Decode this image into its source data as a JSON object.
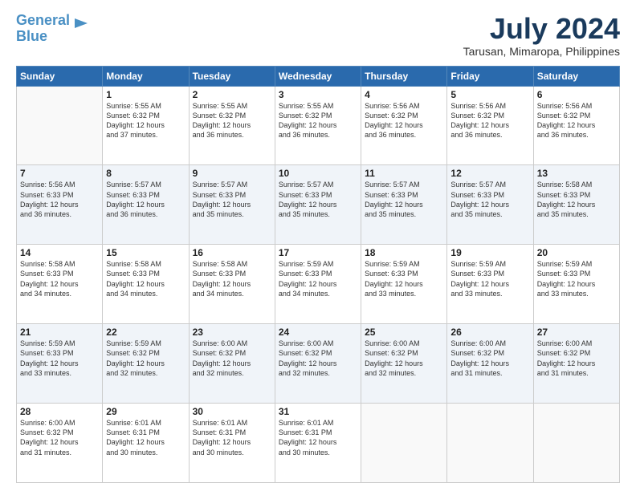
{
  "logo": {
    "line1": "General",
    "line2": "Blue"
  },
  "header": {
    "title": "July 2024",
    "location": "Tarusan, Mimaropa, Philippines"
  },
  "days_of_week": [
    "Sunday",
    "Monday",
    "Tuesday",
    "Wednesday",
    "Thursday",
    "Friday",
    "Saturday"
  ],
  "weeks": [
    [
      {
        "day": "",
        "info": ""
      },
      {
        "day": "1",
        "info": "Sunrise: 5:55 AM\nSunset: 6:32 PM\nDaylight: 12 hours\nand 37 minutes."
      },
      {
        "day": "2",
        "info": "Sunrise: 5:55 AM\nSunset: 6:32 PM\nDaylight: 12 hours\nand 36 minutes."
      },
      {
        "day": "3",
        "info": "Sunrise: 5:55 AM\nSunset: 6:32 PM\nDaylight: 12 hours\nand 36 minutes."
      },
      {
        "day": "4",
        "info": "Sunrise: 5:56 AM\nSunset: 6:32 PM\nDaylight: 12 hours\nand 36 minutes."
      },
      {
        "day": "5",
        "info": "Sunrise: 5:56 AM\nSunset: 6:32 PM\nDaylight: 12 hours\nand 36 minutes."
      },
      {
        "day": "6",
        "info": "Sunrise: 5:56 AM\nSunset: 6:32 PM\nDaylight: 12 hours\nand 36 minutes."
      }
    ],
    [
      {
        "day": "7",
        "info": "Sunrise: 5:56 AM\nSunset: 6:33 PM\nDaylight: 12 hours\nand 36 minutes."
      },
      {
        "day": "8",
        "info": "Sunrise: 5:57 AM\nSunset: 6:33 PM\nDaylight: 12 hours\nand 36 minutes."
      },
      {
        "day": "9",
        "info": "Sunrise: 5:57 AM\nSunset: 6:33 PM\nDaylight: 12 hours\nand 35 minutes."
      },
      {
        "day": "10",
        "info": "Sunrise: 5:57 AM\nSunset: 6:33 PM\nDaylight: 12 hours\nand 35 minutes."
      },
      {
        "day": "11",
        "info": "Sunrise: 5:57 AM\nSunset: 6:33 PM\nDaylight: 12 hours\nand 35 minutes."
      },
      {
        "day": "12",
        "info": "Sunrise: 5:57 AM\nSunset: 6:33 PM\nDaylight: 12 hours\nand 35 minutes."
      },
      {
        "day": "13",
        "info": "Sunrise: 5:58 AM\nSunset: 6:33 PM\nDaylight: 12 hours\nand 35 minutes."
      }
    ],
    [
      {
        "day": "14",
        "info": "Sunrise: 5:58 AM\nSunset: 6:33 PM\nDaylight: 12 hours\nand 34 minutes."
      },
      {
        "day": "15",
        "info": "Sunrise: 5:58 AM\nSunset: 6:33 PM\nDaylight: 12 hours\nand 34 minutes."
      },
      {
        "day": "16",
        "info": "Sunrise: 5:58 AM\nSunset: 6:33 PM\nDaylight: 12 hours\nand 34 minutes."
      },
      {
        "day": "17",
        "info": "Sunrise: 5:59 AM\nSunset: 6:33 PM\nDaylight: 12 hours\nand 34 minutes."
      },
      {
        "day": "18",
        "info": "Sunrise: 5:59 AM\nSunset: 6:33 PM\nDaylight: 12 hours\nand 33 minutes."
      },
      {
        "day": "19",
        "info": "Sunrise: 5:59 AM\nSunset: 6:33 PM\nDaylight: 12 hours\nand 33 minutes."
      },
      {
        "day": "20",
        "info": "Sunrise: 5:59 AM\nSunset: 6:33 PM\nDaylight: 12 hours\nand 33 minutes."
      }
    ],
    [
      {
        "day": "21",
        "info": "Sunrise: 5:59 AM\nSunset: 6:33 PM\nDaylight: 12 hours\nand 33 minutes."
      },
      {
        "day": "22",
        "info": "Sunrise: 5:59 AM\nSunset: 6:32 PM\nDaylight: 12 hours\nand 32 minutes."
      },
      {
        "day": "23",
        "info": "Sunrise: 6:00 AM\nSunset: 6:32 PM\nDaylight: 12 hours\nand 32 minutes."
      },
      {
        "day": "24",
        "info": "Sunrise: 6:00 AM\nSunset: 6:32 PM\nDaylight: 12 hours\nand 32 minutes."
      },
      {
        "day": "25",
        "info": "Sunrise: 6:00 AM\nSunset: 6:32 PM\nDaylight: 12 hours\nand 32 minutes."
      },
      {
        "day": "26",
        "info": "Sunrise: 6:00 AM\nSunset: 6:32 PM\nDaylight: 12 hours\nand 31 minutes."
      },
      {
        "day": "27",
        "info": "Sunrise: 6:00 AM\nSunset: 6:32 PM\nDaylight: 12 hours\nand 31 minutes."
      }
    ],
    [
      {
        "day": "28",
        "info": "Sunrise: 6:00 AM\nSunset: 6:32 PM\nDaylight: 12 hours\nand 31 minutes."
      },
      {
        "day": "29",
        "info": "Sunrise: 6:01 AM\nSunset: 6:31 PM\nDaylight: 12 hours\nand 30 minutes."
      },
      {
        "day": "30",
        "info": "Sunrise: 6:01 AM\nSunset: 6:31 PM\nDaylight: 12 hours\nand 30 minutes."
      },
      {
        "day": "31",
        "info": "Sunrise: 6:01 AM\nSunset: 6:31 PM\nDaylight: 12 hours\nand 30 minutes."
      },
      {
        "day": "",
        "info": ""
      },
      {
        "day": "",
        "info": ""
      },
      {
        "day": "",
        "info": ""
      }
    ]
  ]
}
